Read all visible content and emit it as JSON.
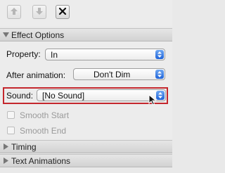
{
  "toolbar": {
    "buttons": [
      {
        "icon": "move-up-icon",
        "enabled": false
      },
      {
        "icon": "move-down-icon",
        "enabled": false
      },
      {
        "icon": "delete-icon",
        "enabled": true
      }
    ]
  },
  "effect_options": {
    "title": "Effect Options",
    "expanded": true,
    "property": {
      "label": "Property:",
      "value": "In"
    },
    "after_animation": {
      "label": "After animation:",
      "value": "Don't Dim"
    },
    "sound": {
      "label": "Sound:",
      "value": "[No Sound]",
      "highlighted": true,
      "highlight_color": "#c4272d"
    },
    "smooth_start": {
      "label": "Smooth Start",
      "checked": false,
      "enabled": false
    },
    "smooth_end": {
      "label": "Smooth End",
      "checked": false,
      "enabled": false
    }
  },
  "timing": {
    "title": "Timing",
    "expanded": false
  },
  "text_animations": {
    "title": "Text Animations",
    "expanded": false
  },
  "colors": {
    "accent": "#1f63d8",
    "highlight": "#c4272d"
  }
}
